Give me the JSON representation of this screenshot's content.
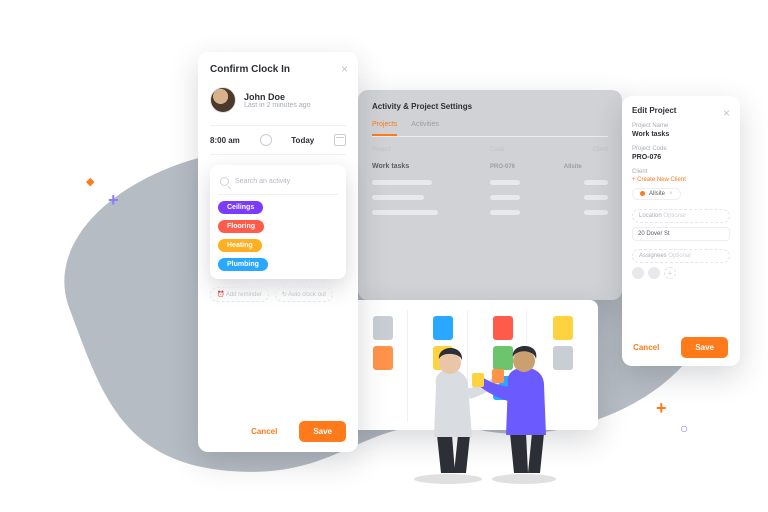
{
  "brand": {
    "accent": "#ff7a1a"
  },
  "decorations": {
    "plus_purple": "+",
    "plus_orange": "+",
    "diamond": "◆",
    "circle": "○"
  },
  "clock": {
    "title": "Confirm Clock In",
    "user": {
      "name": "John Doe",
      "sub": "Last in 2 minutes ago"
    },
    "time": "8:00 am",
    "day": "Today",
    "search_placeholder": "Search an activity",
    "activities": [
      {
        "label": "Ceilings",
        "color": "#7a3bff"
      },
      {
        "label": "Flooring",
        "color": "#ff5b4a"
      },
      {
        "label": "Heating",
        "color": "#ffb020"
      },
      {
        "label": "Plumbing",
        "color": "#2aa7ff"
      }
    ],
    "options": {
      "reminder": "Add reminder",
      "auto": "Auto clock out"
    },
    "cancel": "Cancel",
    "save": "Save"
  },
  "settings": {
    "title": "Activity & Project Settings",
    "tabs": [
      "Projects",
      "Activities"
    ],
    "active_tab": 0,
    "columns": [
      "Project",
      "Code",
      "Client"
    ],
    "rows": [
      {
        "project": "Work tasks",
        "code": "PRO-076",
        "client": "Allsite"
      }
    ]
  },
  "edit": {
    "title": "Edit Project",
    "name_label": "Project Name",
    "name": "Work tasks",
    "code_label": "Project Code",
    "code": "PRO-076",
    "client_label": "Client",
    "new_client": "+ Create New Client",
    "client": "Allsite",
    "location_label": "Location",
    "location": "20 Dover St",
    "assignees_label": "Assignees",
    "cancel": "Cancel",
    "save": "Save"
  },
  "kanban": {
    "notes": [
      [
        "#c9cdd4",
        "#ff934a"
      ],
      [
        "#2aa7ff",
        "#ffd23f"
      ],
      [
        "#ff5b4a",
        "#6cc46c",
        "#2aa7ff"
      ],
      [
        "#ffd23f",
        "#c9cdd4"
      ]
    ]
  }
}
